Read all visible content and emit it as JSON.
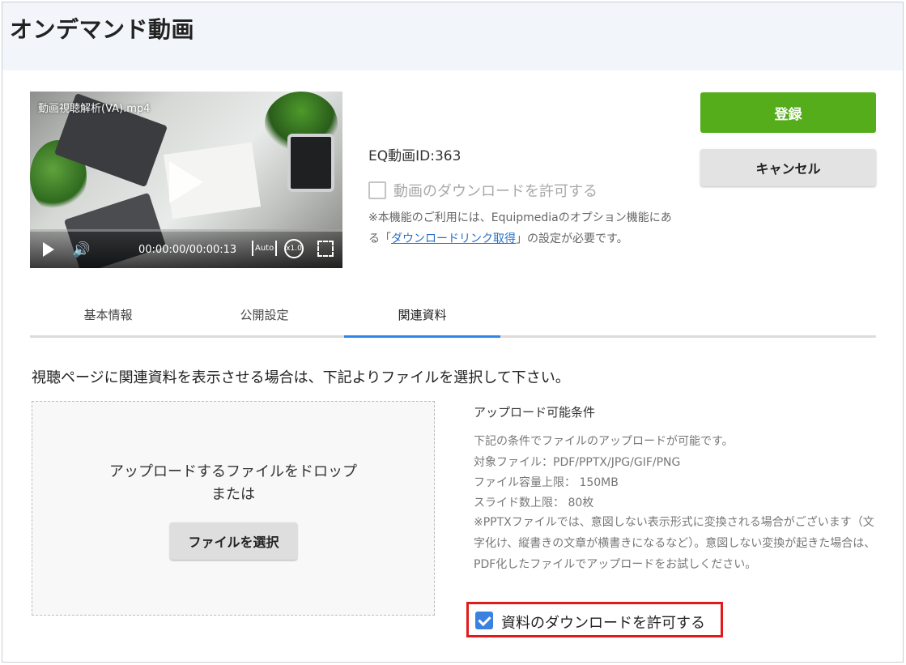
{
  "page": {
    "title": "オンデマンド動画"
  },
  "video": {
    "filename": "動画視聴解析(VA).mp4",
    "time": "00:00:00/00:00:13",
    "quality": "Auto",
    "speed": "x1.0"
  },
  "eq_id": "EQ動画ID:363",
  "video_download": {
    "label": "動画のダウンロードを許可する",
    "checked": false,
    "note_before": "※本機能のご利用には、Equipmediaのオプション機能にある「",
    "note_link": "ダウンロードリンク取得",
    "note_after": "」の設定が必要です。"
  },
  "buttons": {
    "register": "登録",
    "cancel": "キャンセル"
  },
  "tabs": [
    {
      "label": "基本情報",
      "active": false
    },
    {
      "label": "公開設定",
      "active": false
    },
    {
      "label": "関連資料",
      "active": true
    }
  ],
  "instruction": "視聴ページに関連資料を表示させる場合は、下記よりファイルを選択して下さい。",
  "dropzone": {
    "line1": "アップロードするファイルをドロップ",
    "line2": "または",
    "button": "ファイルを選択"
  },
  "conditions": {
    "title": "アップロード可能条件",
    "intro": "下記の条件でファイルのアップロードが可能です。",
    "file_types": "対象ファイル：PDF/PPTX/JPG/GIF/PNG",
    "size_limit": "ファイル容量上限： 150MB",
    "slide_limit": "スライド数上限： 80枚",
    "pptx_note": "※PPTXファイルでは、意図しない表示形式に変換される場合がございます（文字化け、縦書きの文章が横書きになるなど）。意図しない変換が起きた場合は、PDF化したファイルでアップロードをお試しください。"
  },
  "material_download": {
    "label": "資料のダウンロードを許可する",
    "checked": true
  },
  "colors": {
    "register": "#55ad1b",
    "active_tab": "#2f86e8",
    "highlight": "#e21a1a",
    "checkbox": "#3b82e0"
  }
}
